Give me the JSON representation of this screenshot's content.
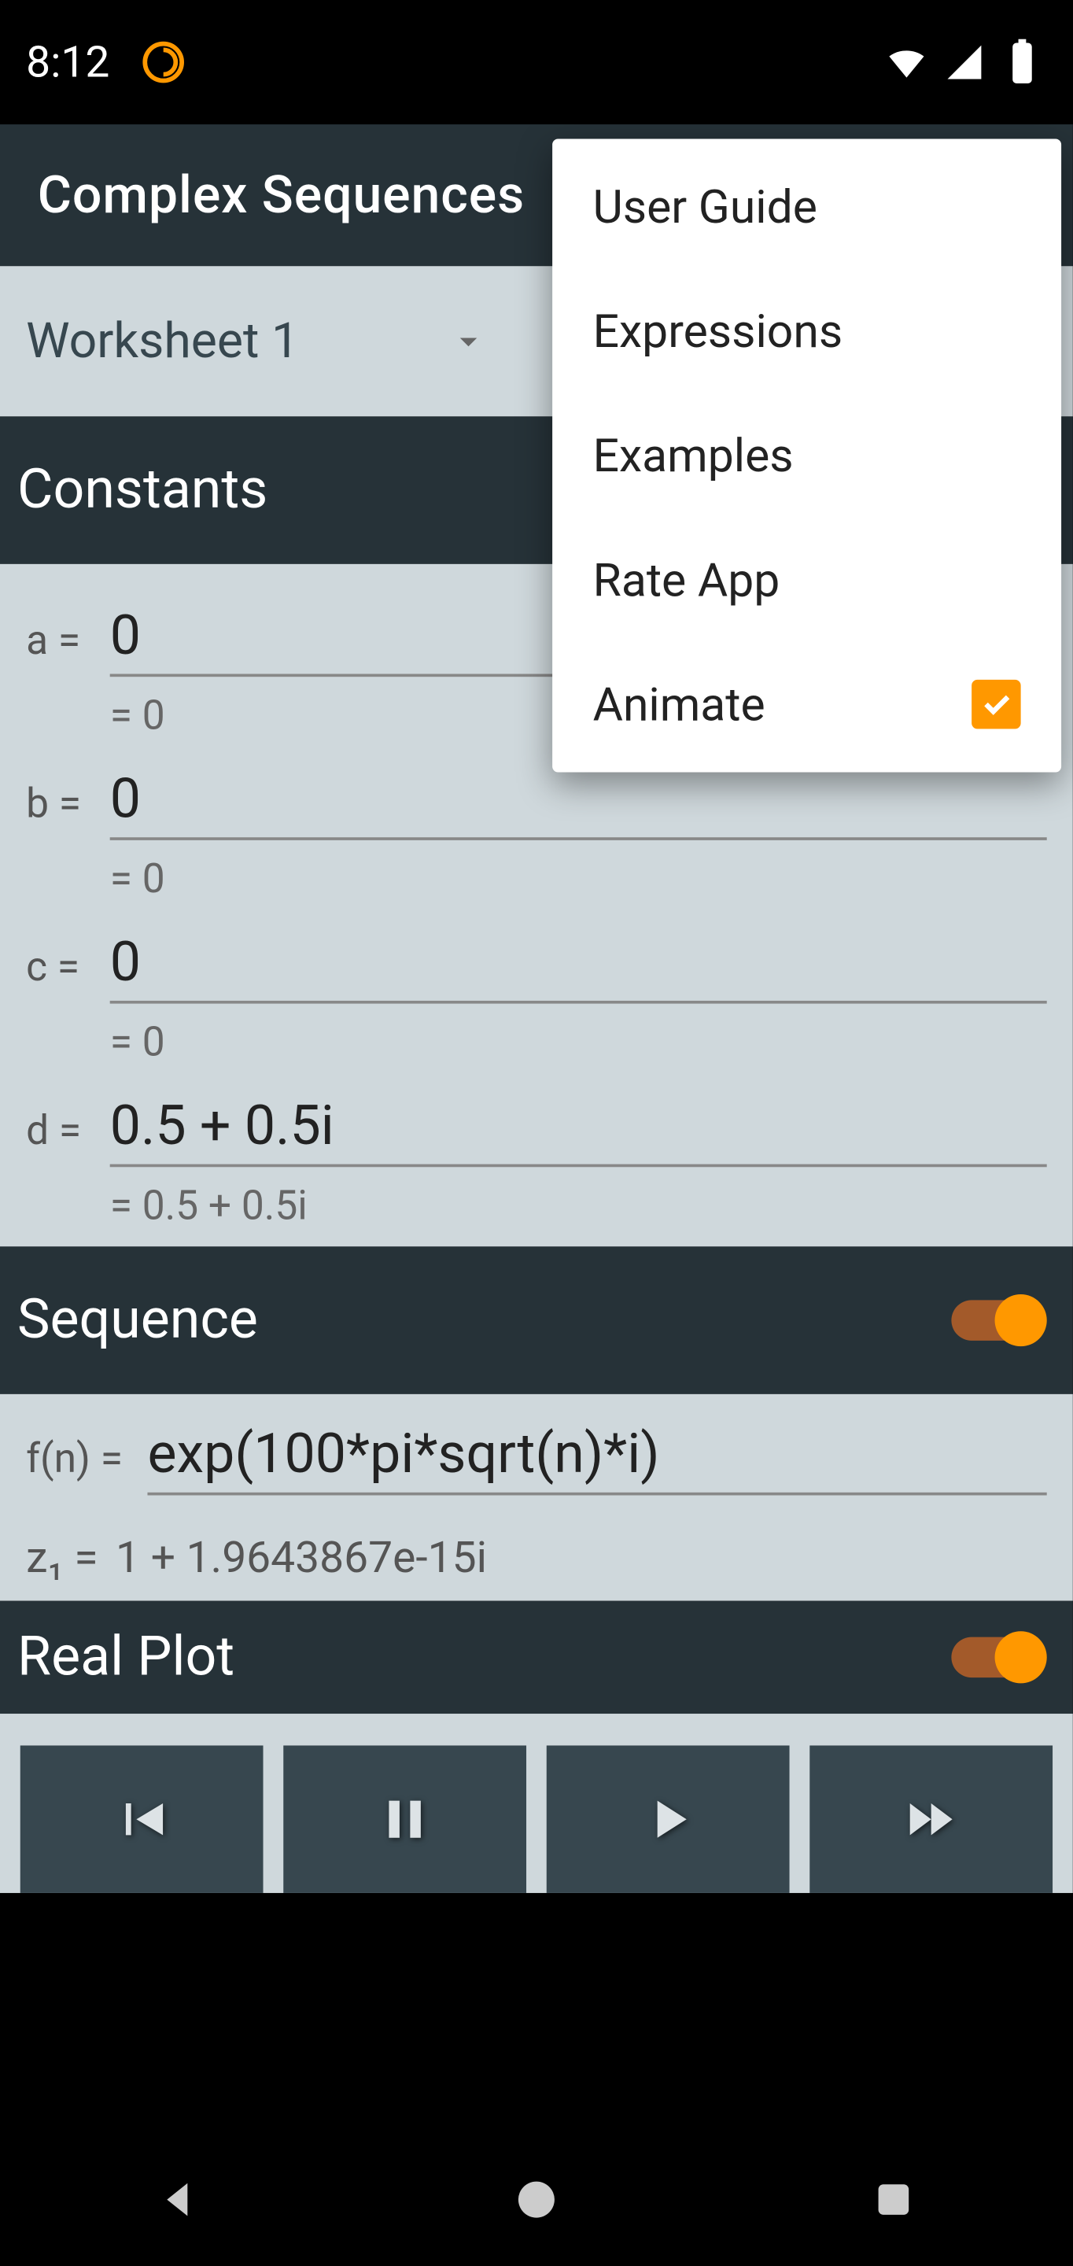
{
  "status": {
    "time": "8:12"
  },
  "app_title": "Complex Sequences",
  "worksheet": {
    "selected": "Worksheet 1"
  },
  "sections": {
    "constants": "Constants",
    "sequence": "Sequence",
    "realplot": "Real Plot"
  },
  "constants": [
    {
      "name": "a",
      "label": "a  =",
      "value": "0",
      "result": "=  0"
    },
    {
      "name": "b",
      "label": "b  =",
      "value": "0",
      "result": "=  0"
    },
    {
      "name": "c",
      "label": "c  =",
      "value": "0",
      "result": "=  0"
    },
    {
      "name": "d",
      "label": "d  =",
      "value": "0.5 + 0.5i",
      "result": "=  0.5 + 0.5i"
    }
  ],
  "sequence": {
    "f_label": "f(n)  =",
    "f_value": "exp(100*pi*sqrt(n)*i)",
    "z_label": "z₁  =",
    "z_value": "1 + 1.9643867e-15i"
  },
  "menu": {
    "items": [
      {
        "label": "User Guide"
      },
      {
        "label": "Expressions"
      },
      {
        "label": "Examples"
      },
      {
        "label": "Rate App"
      },
      {
        "label": "Animate",
        "checked": true
      }
    ]
  }
}
